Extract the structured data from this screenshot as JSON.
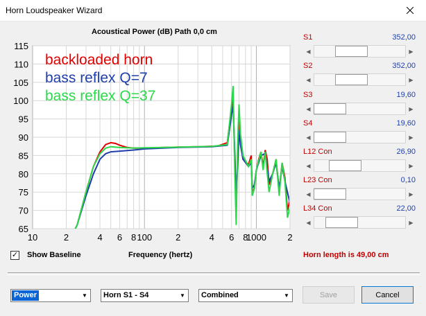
{
  "window": {
    "title": "Horn Loudspeaker Wizard"
  },
  "chart_data": {
    "type": "line",
    "title": "Acoustical Power (dB)   Path 0,0 cm",
    "xlabel": "Frequency (hertz)",
    "ylabel": "",
    "x_scale": "log",
    "xlim": [
      10,
      2000
    ],
    "ylim": [
      65,
      115
    ],
    "y_ticks": [
      65,
      70,
      75,
      80,
      85,
      90,
      95,
      100,
      105,
      110,
      115
    ],
    "x_tick_labels": [
      {
        "x": 10,
        "label": "10"
      },
      {
        "x": 20,
        "label": "2"
      },
      {
        "x": 40,
        "label": "4"
      },
      {
        "x": 60,
        "label": "6"
      },
      {
        "x": 80,
        "label": "8"
      },
      {
        "x": 100,
        "label": "100"
      },
      {
        "x": 200,
        "label": "2"
      },
      {
        "x": 400,
        "label": "4"
      },
      {
        "x": 600,
        "label": "6"
      },
      {
        "x": 800,
        "label": "8"
      },
      {
        "x": 1000,
        "label": "1000"
      },
      {
        "x": 2000,
        "label": "2"
      }
    ],
    "grid": true,
    "legend": "top-left",
    "series": [
      {
        "name": "backloaded horn",
        "color": "#e00000",
        "points": [
          [
            20,
            60
          ],
          [
            25,
            66
          ],
          [
            30,
            75
          ],
          [
            35,
            82
          ],
          [
            40,
            86
          ],
          [
            45,
            88
          ],
          [
            50,
            88.5
          ],
          [
            55,
            88.3
          ],
          [
            60,
            87.8
          ],
          [
            70,
            87.2
          ],
          [
            80,
            87
          ],
          [
            100,
            87
          ],
          [
            150,
            87.2
          ],
          [
            200,
            87.3
          ],
          [
            300,
            87.4
          ],
          [
            450,
            87.6
          ],
          [
            550,
            88.5
          ],
          [
            600,
            98
          ],
          [
            620,
            101
          ],
          [
            640,
            84
          ],
          [
            660,
            70
          ],
          [
            680,
            84
          ],
          [
            700,
            95
          ],
          [
            720,
            90
          ],
          [
            760,
            84
          ],
          [
            850,
            82.5
          ],
          [
            900,
            85
          ],
          [
            920,
            75
          ],
          [
            960,
            76
          ],
          [
            1000,
            81
          ],
          [
            1050,
            84
          ],
          [
            1100,
            86
          ],
          [
            1150,
            82
          ],
          [
            1200,
            86.5
          ],
          [
            1250,
            84
          ],
          [
            1300,
            77
          ],
          [
            1400,
            80
          ],
          [
            1500,
            84
          ],
          [
            1600,
            75
          ],
          [
            1700,
            83
          ],
          [
            1800,
            79
          ],
          [
            1900,
            70
          ],
          [
            2000,
            73
          ]
        ]
      },
      {
        "name": "bass reflex Q=7",
        "color": "#1f3fa8",
        "points": [
          [
            20,
            60
          ],
          [
            25,
            66
          ],
          [
            30,
            74
          ],
          [
            35,
            80
          ],
          [
            40,
            84
          ],
          [
            45,
            85.5
          ],
          [
            50,
            86
          ],
          [
            60,
            86.2
          ],
          [
            80,
            86.5
          ],
          [
            100,
            86.8
          ],
          [
            200,
            87.2
          ],
          [
            400,
            87.4
          ],
          [
            550,
            87.8
          ],
          [
            600,
            96
          ],
          [
            620,
            99
          ],
          [
            640,
            87
          ],
          [
            660,
            74
          ],
          [
            680,
            82
          ],
          [
            700,
            92
          ],
          [
            720,
            88
          ],
          [
            760,
            84
          ],
          [
            850,
            82
          ],
          [
            900,
            83
          ],
          [
            920,
            76
          ],
          [
            960,
            77
          ],
          [
            1000,
            81
          ],
          [
            1100,
            85
          ],
          [
            1200,
            85.5
          ],
          [
            1300,
            78
          ],
          [
            1400,
            80
          ],
          [
            1500,
            83
          ],
          [
            1600,
            76
          ],
          [
            1700,
            82
          ],
          [
            1800,
            78
          ],
          [
            2000,
            72
          ]
        ]
      },
      {
        "name": "bass reflex Q=37",
        "color": "#2bd94a",
        "points": [
          [
            20,
            60
          ],
          [
            25,
            66
          ],
          [
            30,
            75
          ],
          [
            35,
            82
          ],
          [
            40,
            85.5
          ],
          [
            45,
            87
          ],
          [
            50,
            87.4
          ],
          [
            60,
            87.2
          ],
          [
            80,
            87
          ],
          [
            100,
            87.1
          ],
          [
            200,
            87.3
          ],
          [
            400,
            87.5
          ],
          [
            550,
            88
          ],
          [
            600,
            99
          ],
          [
            620,
            104
          ],
          [
            640,
            82
          ],
          [
            660,
            66
          ],
          [
            680,
            88
          ],
          [
            700,
            99
          ],
          [
            720,
            91
          ],
          [
            760,
            85
          ],
          [
            850,
            82
          ],
          [
            900,
            84
          ],
          [
            920,
            74
          ],
          [
            960,
            76
          ],
          [
            1000,
            81
          ],
          [
            1100,
            86
          ],
          [
            1150,
            81
          ],
          [
            1200,
            86
          ],
          [
            1300,
            75
          ],
          [
            1400,
            80
          ],
          [
            1500,
            84
          ],
          [
            1600,
            74
          ],
          [
            1700,
            83
          ],
          [
            1800,
            78
          ],
          [
            1900,
            68
          ],
          [
            2000,
            71
          ]
        ]
      }
    ]
  },
  "sliders": [
    {
      "label": "S1",
      "value": "352,00",
      "position": 0.36
    },
    {
      "label": "S2",
      "value": "352,00",
      "position": 0.36
    },
    {
      "label": "S3",
      "value": "19,60",
      "position": 0.0
    },
    {
      "label": "S4",
      "value": "19,60",
      "position": 0.0
    },
    {
      "label": "L12  Con",
      "value": "26,90",
      "position": 0.25
    },
    {
      "label": "L23  Con",
      "value": "0,10",
      "position": 0.0
    },
    {
      "label": "L34  Con",
      "value": "22,00",
      "position": 0.2
    }
  ],
  "baseline": {
    "label": "Show Baseline",
    "checked": true,
    "check_mark": "✓"
  },
  "horn_length": "Horn length is 49,00 cm",
  "bottom": {
    "mode_select": "Power",
    "range_select": "Horn S1 - S4",
    "combine_select": "Combined",
    "save_label": "Save",
    "cancel_label": "Cancel"
  },
  "colors": {
    "label_red": "#c00000",
    "value_blue": "#1f3fa8",
    "selected_blue": "#0a64d6"
  }
}
